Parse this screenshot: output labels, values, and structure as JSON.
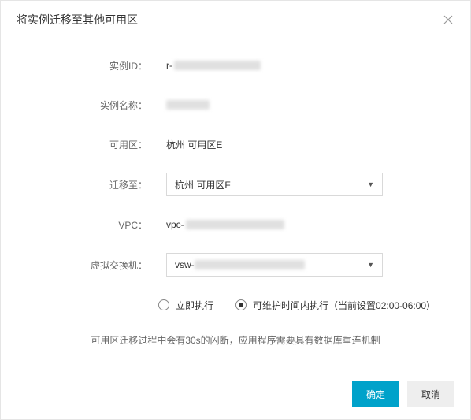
{
  "header": {
    "title": "将实例迁移至其他可用区"
  },
  "form": {
    "instanceId": {
      "label": "实例ID：",
      "prefix": "r-",
      "masked": true
    },
    "instanceName": {
      "label": "实例名称：",
      "masked": true
    },
    "availabilityZone": {
      "label": "可用区：",
      "value": "杭州 可用区E"
    },
    "migrateTo": {
      "label": "迁移至：",
      "selected": "杭州 可用区F"
    },
    "vpc": {
      "label": "VPC：",
      "prefix": "vpc-",
      "masked": true
    },
    "vswitch": {
      "label": "虚拟交换机：",
      "prefix": "vsw-",
      "masked": true
    },
    "execution": {
      "immediate": {
        "label": "立即执行",
        "checked": false
      },
      "maintenance": {
        "label": "可维护时间内执行（当前设置02:00-06:00）",
        "checked": true
      }
    }
  },
  "note": "可用区迁移过程中会有30s的闪断，应用程序需要具有数据库重连机制",
  "footer": {
    "confirm": "确定",
    "cancel": "取消"
  }
}
